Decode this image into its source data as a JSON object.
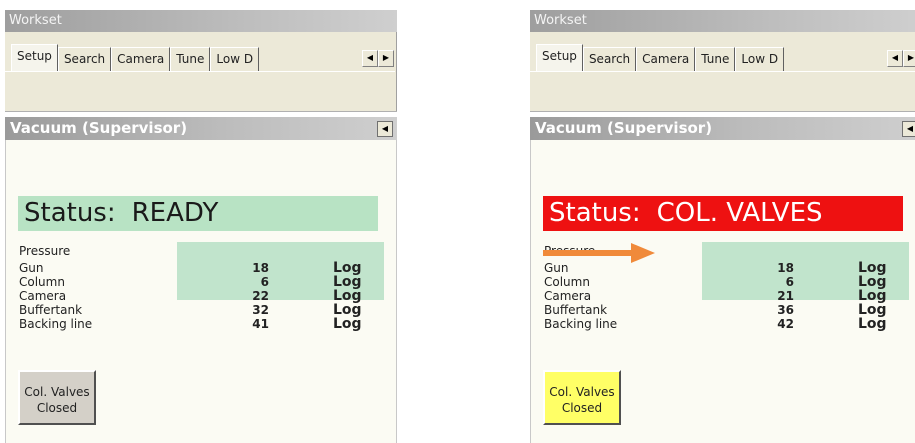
{
  "left": {
    "workset_title": "Workset",
    "tabs": [
      "Setup",
      "Search",
      "Camera",
      "Tune",
      "Low D"
    ],
    "section_title": "Vacuum (Supervisor)",
    "status_label": "Status:",
    "status_value": "READY",
    "pressure_title": "Pressure",
    "rows": [
      {
        "name": "Gun",
        "value": "18",
        "unit": "Log"
      },
      {
        "name": "Column",
        "value": "6",
        "unit": "Log"
      },
      {
        "name": "Camera",
        "value": "22",
        "unit": "Log"
      },
      {
        "name": "Buffertank",
        "value": "32",
        "unit": "Log"
      },
      {
        "name": "Backing line",
        "value": "41",
        "unit": "Log"
      }
    ],
    "valves_line1": "Col. Valves",
    "valves_line2": "Closed"
  },
  "right": {
    "workset_title": "Workset",
    "tabs": [
      "Setup",
      "Search",
      "Camera",
      "Tune",
      "Low D"
    ],
    "section_title": "Vacuum (Supervisor)",
    "status_label": "Status:",
    "status_value": "COL. VALVES",
    "pressure_title": "Pressure",
    "rows": [
      {
        "name": "Gun",
        "value": "18",
        "unit": "Log"
      },
      {
        "name": "Column",
        "value": "6",
        "unit": "Log"
      },
      {
        "name": "Camera",
        "value": "21",
        "unit": "Log"
      },
      {
        "name": "Buffertank",
        "value": "36",
        "unit": "Log"
      },
      {
        "name": "Backing line",
        "value": "42",
        "unit": "Log"
      }
    ],
    "valves_line1": "Col. Valves",
    "valves_line2": "Closed"
  },
  "colors": {
    "status_ready_bg": "#b8e3c4",
    "status_alert_bg": "#ee1111",
    "valves_closed_grey": "#d4d0c8",
    "valves_closed_yellow": "#ffff66",
    "pressure_highlight": "#c1e4cc",
    "annotation_arrow": "#f08a3a"
  },
  "icons": {
    "scroll_left": "scroll-left-icon",
    "scroll_right": "scroll-right-icon",
    "collapse": "collapse-icon",
    "annotation": "arrow-right-icon"
  }
}
